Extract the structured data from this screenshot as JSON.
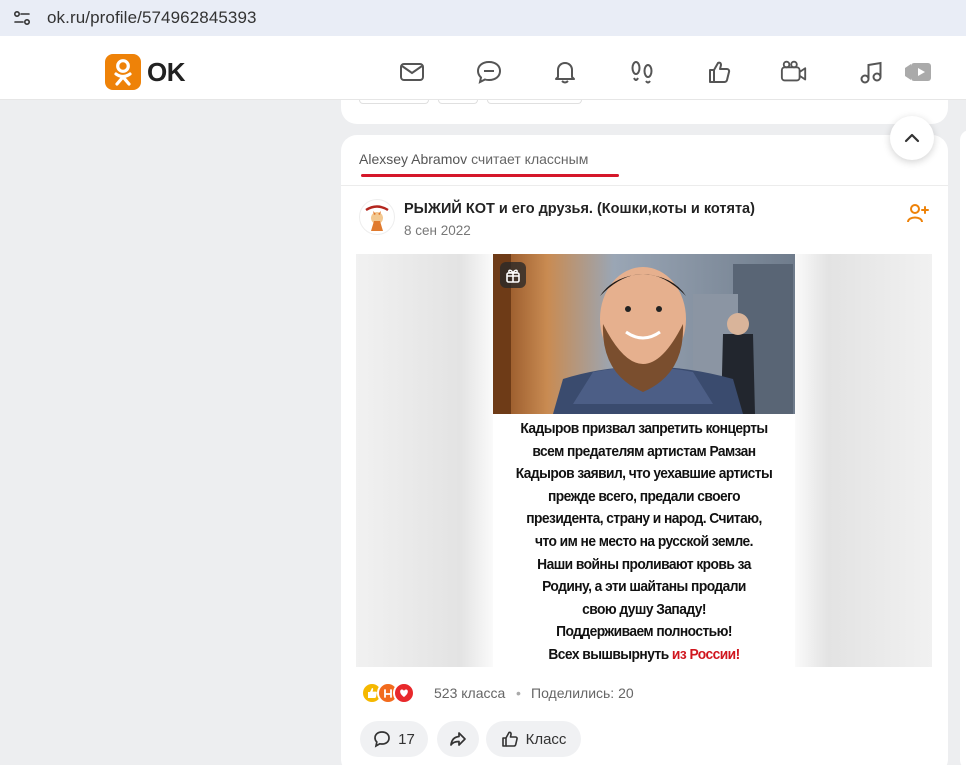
{
  "browser": {
    "url": "ok.ru/profile/574962845393"
  },
  "header": {
    "logo_text": "OK",
    "nav": [
      {
        "icon": "mail-icon"
      },
      {
        "icon": "discussions-icon"
      },
      {
        "icon": "notifications-icon"
      },
      {
        "icon": "guests-icon"
      },
      {
        "icon": "likes-icon"
      },
      {
        "icon": "video-icon"
      },
      {
        "icon": "music-icon"
      },
      {
        "icon": "video-play-icon"
      }
    ],
    "accent_color": "#ee8208"
  },
  "post": {
    "liked_by_name": "Alexsey Abramov",
    "liked_by_suffix": "считает классным",
    "group_name": "РЫЖИЙ КОТ и его друзья. (Кошки,коты и котята)",
    "date": "8 сен 2022",
    "caption_lines": [
      "Кадыров призвал запретить концерты",
      "всем предателям артистам Рамзан",
      "Кадыров заявил, что уехавшие артисты",
      "прежде всего, предали своего",
      "президента, страну и народ. Считаю,",
      "что им не место на русской земле.",
      "Наши войны проливают кровь за",
      "Родину, а эти шайтаны продали",
      "свою душу Западу!",
      "Поддерживаем полностью!"
    ],
    "caption_last_black": "Всех вышвырнуть",
    "caption_last_red": "из России!",
    "reactions_count": "523 класса",
    "shares": "Поделились: 20",
    "comments_count": "17",
    "class_label": "Класс"
  }
}
